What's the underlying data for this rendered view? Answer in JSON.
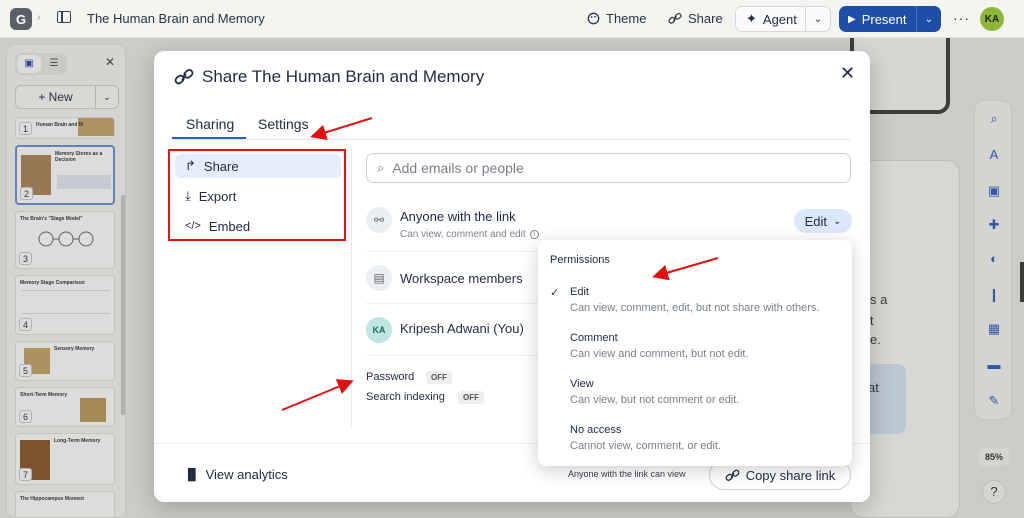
{
  "topbar": {
    "logo_letter": "G",
    "doc_title": "The Human Brain and Memory",
    "theme_label": "Theme",
    "share_label": "Share",
    "agent_label": "Agent",
    "present_label": "Present",
    "more_label": "···",
    "user_initials": "KA"
  },
  "slides_panel": {
    "new_label": "New",
    "slides": [
      {
        "num": "1",
        "title": "Human Brain and M"
      },
      {
        "num": "2",
        "title": "Memory Stores as a Decision"
      },
      {
        "num": "3",
        "title": "The Brain's \"Stage Model\""
      },
      {
        "num": "4",
        "title": "Memory Stage Comparison"
      },
      {
        "num": "5",
        "title": "Sensory Memory"
      },
      {
        "num": "6",
        "title": "Short-Term Memory"
      },
      {
        "num": "7",
        "title": "Long-Term Memory"
      },
      {
        "num": "",
        "title": "The Hippocampus Moment"
      }
    ]
  },
  "canvas": {
    "text_1": "s a",
    "text_2": "t",
    "text_3": "e.",
    "text_4": "at",
    "zoom": "85%",
    "help": "?"
  },
  "modal": {
    "title": "Share The Human Brain and Memory",
    "tabs": [
      {
        "label": "Sharing"
      },
      {
        "label": "Settings"
      }
    ],
    "nav": [
      {
        "label": "Share",
        "icon": "share-arrow-icon"
      },
      {
        "label": "Export",
        "icon": "download-icon"
      },
      {
        "label": "Embed",
        "icon": "code-icon"
      }
    ],
    "search": {
      "placeholder": "Add emails or people"
    },
    "link_access": {
      "title": "Anyone with the link",
      "subtitle": "Can view, comment and edit",
      "permission": "Edit"
    },
    "workspace": {
      "title": "Workspace members"
    },
    "owner": {
      "initials": "KA",
      "name": "Kripesh Adwani (You)"
    },
    "options": [
      {
        "label": "Password",
        "state": "OFF"
      },
      {
        "label": "Search indexing",
        "state": "OFF"
      }
    ],
    "footer": {
      "analytics_label": "View analytics",
      "note": "Anyone with the link can view",
      "copy_label": "Copy share link"
    }
  },
  "permissions_menu": {
    "heading": "Permissions",
    "options": [
      {
        "name": "Edit",
        "desc": "Can view, comment, edit, but not share with others.",
        "selected": true
      },
      {
        "name": "Comment",
        "desc": "Can view and comment, but not edit.",
        "selected": false
      },
      {
        "name": "View",
        "desc": "Can view, but not comment or edit.",
        "selected": false
      },
      {
        "name": "No access",
        "desc": "Cannot view, comment, or edit.",
        "selected": false
      }
    ]
  },
  "colors": {
    "accent": "#1f4ea8",
    "annotation": "#e11111",
    "nav_active_bg": "#e4edfb"
  }
}
